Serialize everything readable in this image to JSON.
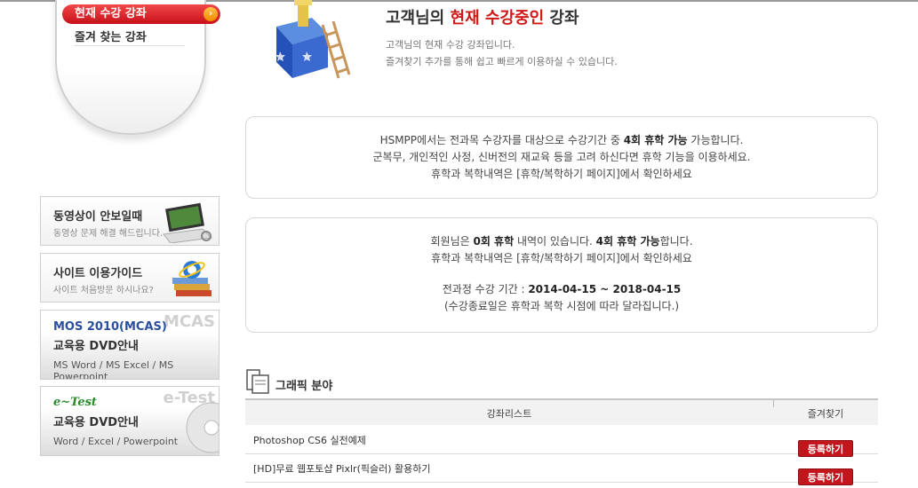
{
  "menu": {
    "active_label": "현재 수강 강좌",
    "active_arrow": "›",
    "second_label": "즐겨 찾는 강좌"
  },
  "header": {
    "title_prefix": "고객님의 ",
    "title_highlight": "현재 수강중인",
    "title_suffix": " 강좌",
    "desc_line1": "고객님의 현재 수강 강좌입니다.",
    "desc_line2": "즐겨찾기 추가를 통해 쉽고 빠르게 이용하실 수 있습니다."
  },
  "banners": [
    {
      "title": "동영상이 안보일때",
      "sub": "동영상 문제 해결 해드립니다."
    },
    {
      "title": "사이트 이용가이드",
      "sub": "사이트 처음방문 하시나요?"
    },
    {
      "title_line1": "MOS 2010(MCAS)",
      "title_line2": "교육용 DVD안내",
      "sub": "MS Word / MS Excel / MS Powerpoint",
      "ghost": "MCAS"
    },
    {
      "title_line1": "e~Test",
      "title_line2": "교육용 DVD안내",
      "sub": "Word / Excel / Powerpoint",
      "ghost": "e-Test"
    }
  ],
  "notice1": {
    "l1_a": "HSMPP에서는 전과목 수강자를 대상으로 수강기간 중 ",
    "l1_b": "4회 휴학 가능",
    "l1_c": " 가능합니다.",
    "l2": "군복무, 개인적인 사정, 신버전의 재교육 등을 고려 하신다면 휴학 기능을 이용하세요.",
    "l3": "휴학과 복학내역은 [휴학/복학하기 페이지]에서 확인하세요"
  },
  "notice2": {
    "l1_a": "회원님은 ",
    "l1_b": "0회 휴학",
    "l1_c": " 내역이 있습니다. ",
    "l1_d": "4회 휴학 가능",
    "l1_e": "합니다.",
    "l2": "휴학과 복학내역은 [휴학/복학하기 페이지]에서 확인하세요",
    "l3_a": "전과정 수강 기간 : ",
    "l3_b": "2014-04-15 ~ 2018-04-15",
    "l4": "(수강종료일은 휴학과 복학 시점에 따라 달라집니다.)"
  },
  "section": {
    "title": "그래픽 분야",
    "col_list": "강좌리스트",
    "col_fav": "즐겨찾기"
  },
  "courses": [
    {
      "name": "Photoshop CS6 실전예제",
      "button": "등록하기"
    },
    {
      "name": "[HD]무료 웹포토샵 Pixlr(픽슬러) 활용하기",
      "button": "등록하기"
    }
  ],
  "colors": {
    "accent_red": "#c2161c",
    "title_highlight": "#d01818",
    "mos_blue": "#2b4f9c",
    "etest_green": "#2c8a2c"
  }
}
